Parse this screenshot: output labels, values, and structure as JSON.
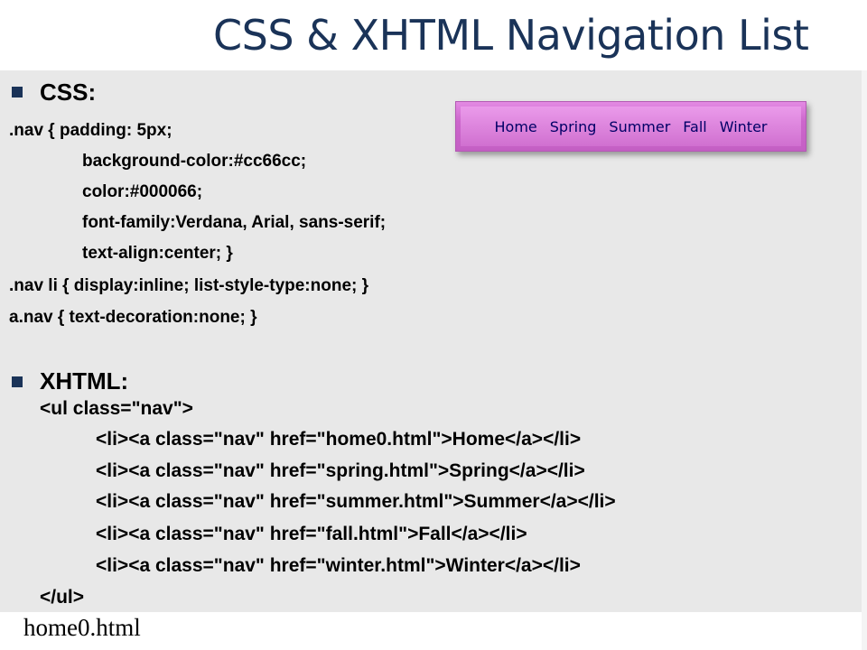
{
  "slide": {
    "title": "CSS & XHTML Navigation List",
    "filename": "home0.html"
  },
  "css_section": {
    "heading": "CSS:",
    "lines": [
      ".nav { padding: 5px;",
      "background-color:#cc66cc;",
      "color:#000066;",
      "font-family:Verdana, Arial, sans-serif;",
      "text-align:center; }",
      ".nav li { display:inline; list-style-type:none; }",
      "a.nav { text-decoration:none; }"
    ]
  },
  "xhtml_section": {
    "heading": "XHTML:",
    "lines": [
      "<ul class=\"nav\">",
      "<li><a class=\"nav\" href=\"home0.html\">Home</a></li>",
      "<li><a class=\"nav\" href=\"spring.html\">Spring</a></li>",
      "<li><a class=\"nav\" href=\"summer.html\">Summer</a></li>",
      "<li><a class=\"nav\" href=\"fall.html\">Fall</a></li>",
      "<li><a class=\"nav\" href=\"winter.html\">Winter</a></li>",
      "</ul>"
    ]
  },
  "nav_preview": {
    "items": [
      "Home",
      "Spring",
      "Summer",
      "Fall",
      "Winter"
    ],
    "background_color": "#cc66cc",
    "text_color": "#000066"
  },
  "colors": {
    "title": "#1a3358",
    "content_background": "#e8e8e8"
  }
}
